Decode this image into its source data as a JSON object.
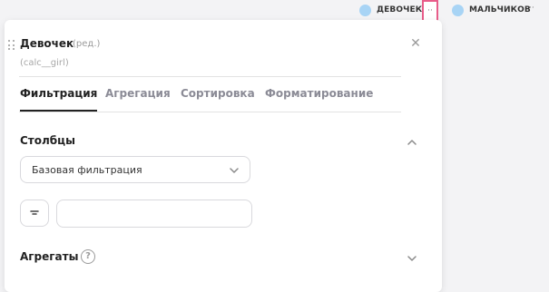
{
  "legend": {
    "items": [
      {
        "label": "ДЕВОЧЕК",
        "color": "#a8d4f5"
      },
      {
        "label": "МАЛЬЧИКОВ",
        "color": "#a8d4f5"
      }
    ],
    "more_glyph": "··"
  },
  "panel": {
    "title": "Девочек",
    "title_edit": "(ред.)",
    "subtitle": "(calc__girl)",
    "close_glyph": "✕",
    "tabs": [
      {
        "label": "Фильтрация",
        "active": true
      },
      {
        "label": "Агрегация",
        "active": false
      },
      {
        "label": "Сортировка",
        "active": false
      },
      {
        "label": "Форматирование",
        "active": false
      }
    ],
    "columns_section": {
      "title": "Столбцы",
      "select_value": "Базовая фильтрация",
      "input_value": ""
    },
    "aggregates_section": {
      "title": "Агрегаты",
      "help_glyph": "?"
    }
  },
  "colors": {
    "highlight": "#e85d8a",
    "legend_dot": "#a8d4f5"
  }
}
